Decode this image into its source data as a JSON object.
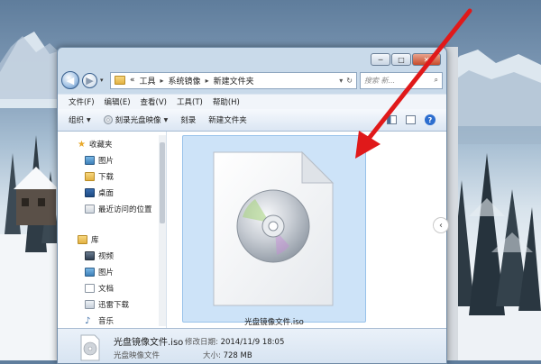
{
  "window": {
    "controls": [
      "─",
      "□",
      "✕"
    ],
    "nav": {
      "back_glyph": "◀",
      "forward_glyph": "▶",
      "dropdown_glyph": "▾"
    },
    "address": {
      "prefix": "«",
      "crumbs": [
        "工具",
        "系统镜像",
        "新建文件夹"
      ],
      "separator": "▸",
      "dropdown_glyph": "▾",
      "refresh_glyph": "↻"
    },
    "search": {
      "placeholder": "搜索 新...",
      "icon_glyph": "⌕"
    }
  },
  "menubar": {
    "items": [
      "文件(F)",
      "编辑(E)",
      "查看(V)",
      "工具(T)",
      "帮助(H)"
    ]
  },
  "toolbar": {
    "organize": "组织",
    "burn_image": "刻录光盘映像",
    "burn": "刻录",
    "new_folder": "新建文件夹",
    "caret": "▼",
    "help_glyph": "?"
  },
  "navpane": {
    "favorites": {
      "label": "收藏夹",
      "items": [
        "图片",
        "下载",
        "桌面",
        "最近访问的位置"
      ]
    },
    "libraries": {
      "label": "库",
      "items": [
        "视频",
        "图片",
        "文档",
        "迅雷下载",
        "音乐"
      ]
    }
  },
  "content": {
    "file_name": "光盘镜像文件.iso"
  },
  "statusbar": {
    "file_name": "光盘镜像文件.iso",
    "modified_key": "修改日期:",
    "modified_value": "2014/11/9 18:05",
    "type": "光盘映像文件",
    "size_key": "大小:",
    "size_value": "728 MB"
  },
  "page": {
    "side_nav_glyph": "‹"
  },
  "colors": {
    "selection_bg": "#cde3f8",
    "arrow": "#e0191a",
    "window_frame": "#c9daea"
  },
  "icons": {
    "favorites": "star-icon",
    "library": "library-icon",
    "file": "disc-image-icon"
  }
}
